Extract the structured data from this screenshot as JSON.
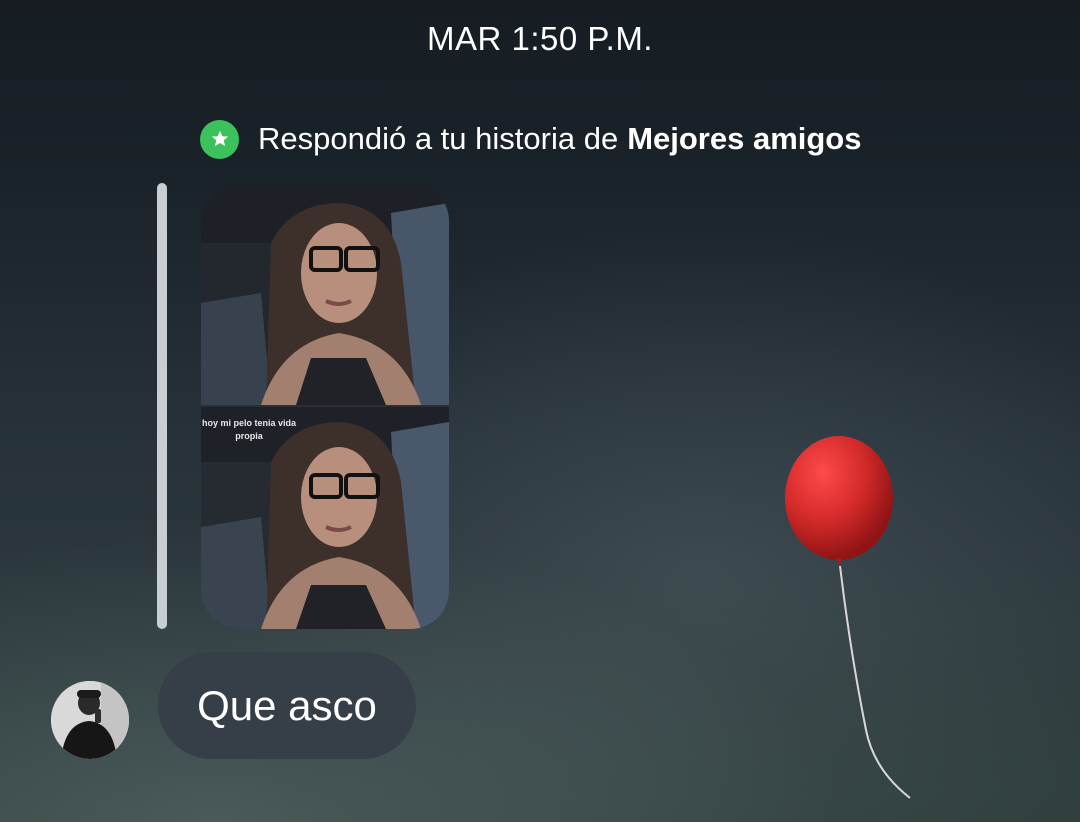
{
  "conversation": {
    "timestamp": "MAR 1:50 P.M.",
    "story_reply": {
      "prefix": "Respondió a tu historia de",
      "list_name": "Mejores amigos",
      "badge_icon": "star-icon",
      "badge_color": "#3cc25a",
      "story_caption": "hoy mi pelo tenia vida propia"
    },
    "messages": [
      {
        "sender": "other",
        "text": "Que asco",
        "bubble_color": "#363f47"
      }
    ]
  },
  "theme": {
    "background_accent": "#31403f",
    "balloon_color": "#d42a2a"
  }
}
